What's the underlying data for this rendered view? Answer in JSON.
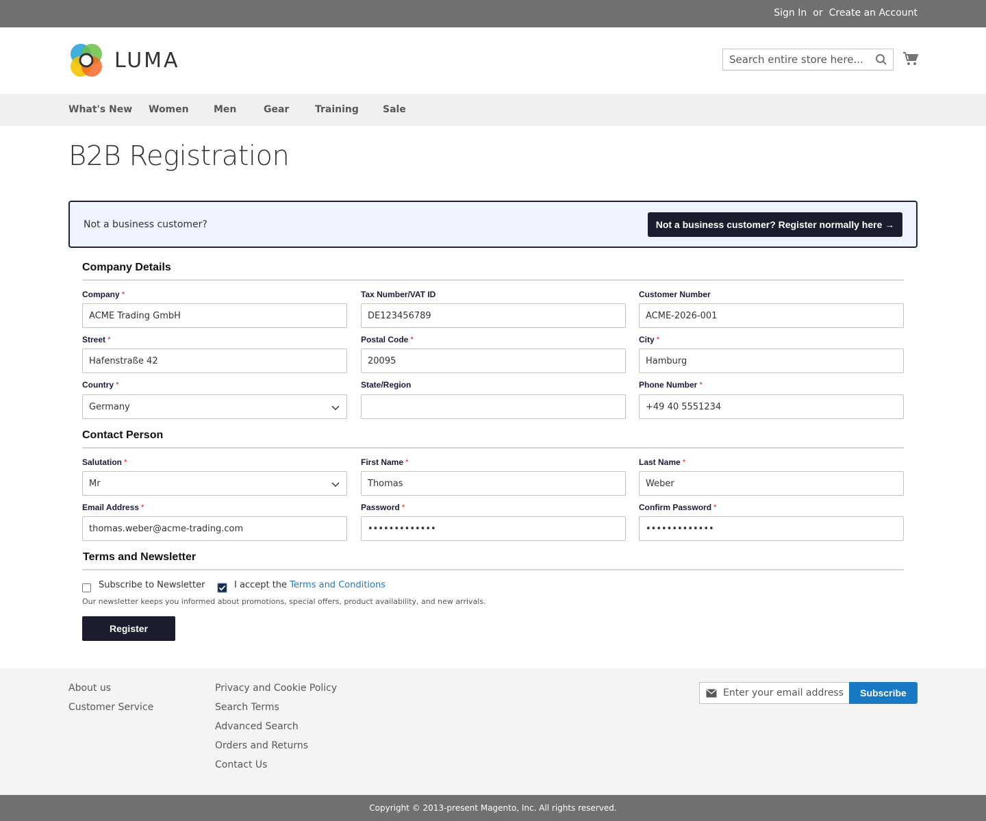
{
  "topbar": {
    "sign_in": "Sign In",
    "or": "or",
    "create_account": "Create an Account"
  },
  "header": {
    "logo_text": "LUMA",
    "search_placeholder": "Search entire store here...",
    "icons": [
      "search-icon",
      "cart-icon"
    ]
  },
  "nav": {
    "items": [
      "What's New",
      "Women",
      "Men",
      "Gear",
      "Training",
      "Sale"
    ]
  },
  "page": {
    "title": "B2B Registration"
  },
  "notice": {
    "text": "Not a business customer?",
    "button": "Not a business customer? Register normally here →"
  },
  "company": {
    "title": "Company Details",
    "company": {
      "label": "Company",
      "value": "ACME Trading GmbH"
    },
    "tax": {
      "label": "Tax Number/VAT ID",
      "value": "DE123456789"
    },
    "customer_number": {
      "label": "Customer Number",
      "value": "ACME-2026-001"
    },
    "street": {
      "label": "Street",
      "value": "Hafenstraße 42"
    },
    "postal": {
      "label": "Postal Code",
      "value": "20095"
    },
    "city": {
      "label": "City",
      "value": "Hamburg"
    },
    "country": {
      "label": "Country",
      "value": "Germany"
    },
    "state": {
      "label": "State/Region",
      "value": ""
    },
    "phone": {
      "label": "Phone Number",
      "value": "+49 40 5551234"
    }
  },
  "contact": {
    "title": "Contact Person",
    "salutation": {
      "label": "Salutation",
      "value": "Mr"
    },
    "first_name": {
      "label": "First Name",
      "value": "Thomas"
    },
    "last_name": {
      "label": "Last Name",
      "value": "Weber"
    },
    "email": {
      "label": "Email Address",
      "value": "thomas.weber@acme-trading.com"
    },
    "password": {
      "label": "Password",
      "value": "•••••••••••••"
    },
    "confirm_password": {
      "label": "Confirm Password",
      "value": "•••••••••••••"
    }
  },
  "terms": {
    "title": "Terms and Newsletter",
    "newsletter_label": "Subscribe to Newsletter",
    "newsletter_checked": false,
    "accept_prefix": "I accept the ",
    "accept_link": "Terms and Conditions",
    "accept_checked": true,
    "hint": "Our newsletter keeps you informed about promotions, special offers, product availability, and new arrivals."
  },
  "register_button": "Register",
  "required_mark": "*",
  "footer": {
    "col1": [
      "About us",
      "Customer Service"
    ],
    "col2": [
      "Privacy and Cookie Policy",
      "Search Terms",
      "Advanced Search",
      "Orders and Returns",
      "Contact Us"
    ],
    "newsletter_placeholder": "Enter your email address",
    "subscribe": "Subscribe"
  },
  "copyright": "Copyright © 2013-present Magento, Inc. All rights reserved.",
  "colors": {
    "brand_dark": "#1b1c2e",
    "link_blue": "#1979c3",
    "topbar": "#6e716e",
    "required": "#e02b27"
  }
}
